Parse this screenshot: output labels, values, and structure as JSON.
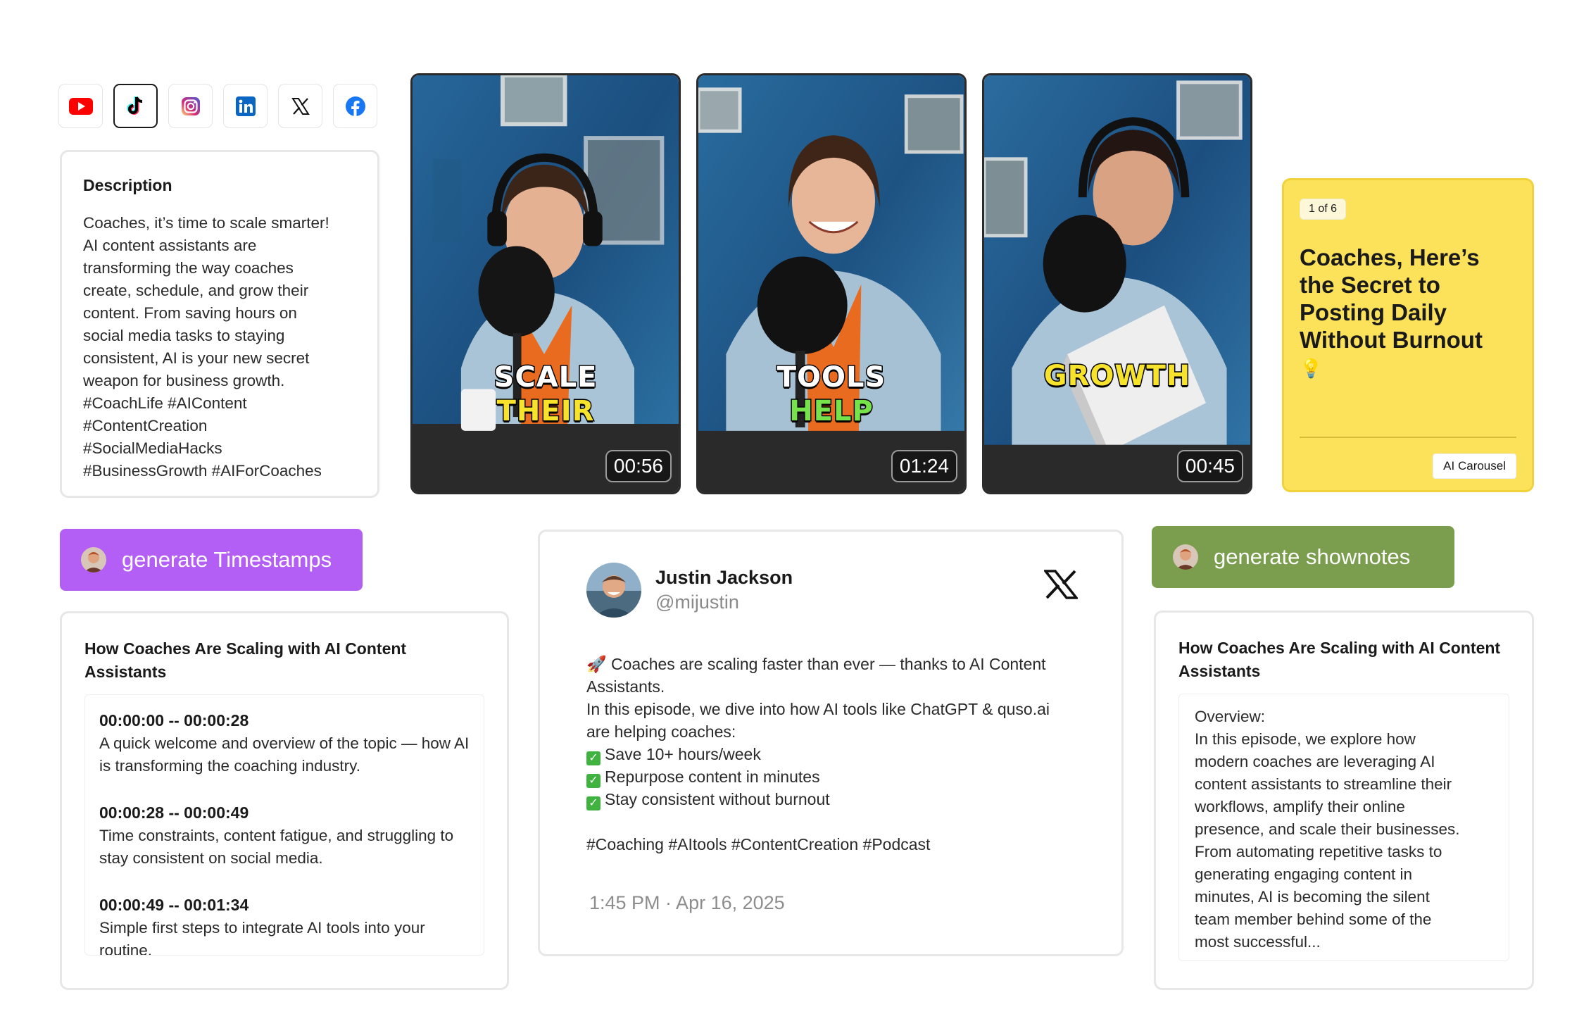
{
  "socials": [
    {
      "icon": "youtube-icon",
      "active": false
    },
    {
      "icon": "tiktok-icon",
      "active": true
    },
    {
      "icon": "instagram-icon",
      "active": false
    },
    {
      "icon": "linkedin-icon",
      "active": false
    },
    {
      "icon": "x-icon",
      "active": false
    },
    {
      "icon": "facebook-icon",
      "active": false
    }
  ],
  "description": {
    "title": "Description",
    "body": "Coaches, it’s time to scale smarter!\nAI content assistants are\ntransforming the way coaches\ncreate, schedule, and grow their\ncontent. From saving hours on\nsocial media tasks to staying\nconsistent, AI is your new secret\nweapon for business growth.\n#CoachLife #AIContent\n#ContentCreation\n#SocialMediaHacks\n#BusinessGrowth #AIForCoaches"
  },
  "videos": [
    {
      "caption_line1": "SCALE",
      "caption_line2": "THEIR",
      "duration": "00:56"
    },
    {
      "caption_line1": "TOOLS",
      "caption_line2": "HELP",
      "duration": "01:24"
    },
    {
      "caption_line1": "GROWTH",
      "caption_line2": "",
      "duration": "00:45"
    }
  ],
  "carousel": {
    "counter": "1 of 6",
    "title": "Coaches, Here’s the Secret to Posting Daily Without Burnout",
    "emoji": "💡",
    "tag": "AI Carousel"
  },
  "buttons": {
    "timestamps": "generate Timestamps",
    "shownotes": "generate shownotes"
  },
  "timestamps": {
    "title": "How Coaches Are Scaling with AI Content Assistants",
    "items": [
      {
        "time": "00:00:00 -- 00:00:28",
        "text": "A quick welcome and overview of the topic — how AI is transforming the coaching industry."
      },
      {
        "time": "00:00:28 -- 00:00:49",
        "text": "Time constraints, content fatigue, and struggling to stay consistent on social media."
      },
      {
        "time": "00:00:49 -- 00:01:34",
        "text": "Simple first steps to integrate AI tools into your routine."
      }
    ]
  },
  "tweet": {
    "name": "Justin Jackson",
    "handle": "@mijustin",
    "intro_emoji": "🚀",
    "line1": "Coaches are scaling faster than ever — thanks to AI Content Assistants.",
    "line2": "In this episode, we dive into how AI tools like ChatGPT & quso.ai are helping coaches:",
    "checks": [
      "Save 10+ hours/week",
      "Repurpose content in minutes",
      "Stay consistent without burnout"
    ],
    "hashtags": "#Coaching #AItools #ContentCreation #Podcast",
    "date": "1:45 PM · Apr 16, 2025"
  },
  "shownotes": {
    "title": "How Coaches Are Scaling with AI Content Assistants",
    "body": "Overview:\nIn this episode, we explore how\nmodern coaches are leveraging AI\ncontent assistants to streamline their\nworkflows, amplify their online\npresence, and scale their businesses.\nFrom automating repetitive tasks to\ngenerating engaging content in\nminutes, AI is becoming the silent\nteam member behind some of the\nmost successful..."
  },
  "colors": {
    "purple": "#b35ef5",
    "green": "#7a9e4e",
    "yellow": "#fce25a"
  }
}
